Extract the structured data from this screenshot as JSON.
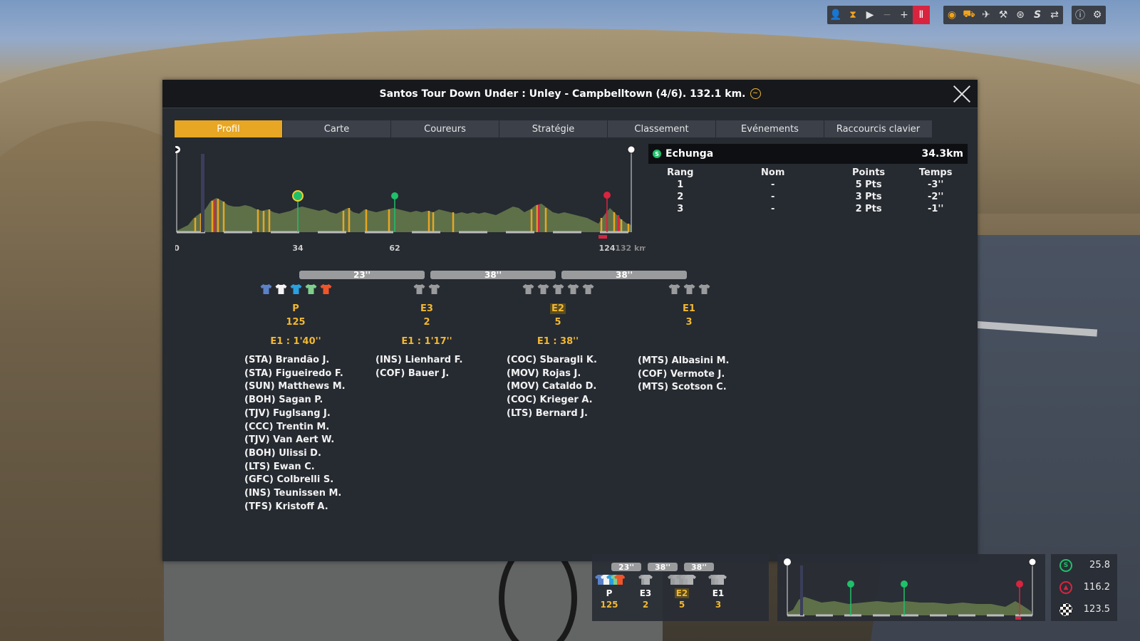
{
  "toolbar": {
    "left_group": [
      "rider-icon",
      "hourglass-icon",
      "play-icon",
      "minus-icon",
      "plus-icon",
      "pause-icon"
    ],
    "right_group": [
      "eye-icon",
      "motorbike-icon",
      "car-icon",
      "helicopter-icon",
      "ball-icon",
      "sprint-s-icon",
      "switch-icon"
    ],
    "extra": [
      "info-icon",
      "settings-icon"
    ]
  },
  "dialog": {
    "title": "Santos Tour Down Under : Unley - Campbelltown (4/6). 132.1 km."
  },
  "tabs": [
    "Profil",
    "Carte",
    "Coureurs",
    "Stratégie",
    "Classement",
    "Evénements",
    "Raccourcis clavier"
  ],
  "profile": {
    "axis_labels": [
      "0",
      "34",
      "62",
      "124"
    ],
    "axis_end": "132 km"
  },
  "sprint": {
    "name": "Echunga",
    "distance": "34.3km",
    "headers": [
      "Rang",
      "Nom",
      "Points",
      "Temps"
    ],
    "rows": [
      [
        "1",
        "-",
        "5 Pts",
        "-3''"
      ],
      [
        "2",
        "-",
        "3 Pts",
        "-2''"
      ],
      [
        "3",
        "-",
        "2 Pts",
        "-1''"
      ]
    ]
  },
  "gaps": [
    "23''",
    "38''",
    "38''"
  ],
  "groups": [
    {
      "name": "P",
      "count": "125",
      "gap": "E1 : 1'40''",
      "riders": [
        "(STA) Brandão J.",
        "(STA) Figueiredo F.",
        "(SUN) Matthews M.",
        "(BOH) Sagan P.",
        "(TJV) Fuglsang J.",
        "(CCC) Trentin M.",
        "(TJV) Van Aert W.",
        "(BOH) Ulissi D.",
        "(LTS) Ewan C.",
        "(GFC) Colbrelli S.",
        "(INS) Teunissen M.",
        "(TFS) Kristoff A."
      ]
    },
    {
      "name": "E3",
      "count": "2",
      "gap": "E1 : 1'17''",
      "riders": [
        "(INS) Lienhard F.",
        "(COF) Bauer J."
      ]
    },
    {
      "name": "E2",
      "count": "5",
      "gap": "E1 : 38''",
      "riders": [
        "(COC) Sbaragli K.",
        "(MOV) Rojas J.",
        "(MOV) Cataldo D.",
        "(COC) Krieger A.",
        "(LTS) Bernard J."
      ]
    },
    {
      "name": "E1",
      "count": "3",
      "gap": "",
      "riders": [
        "(MTS) Albasini M.",
        "(COF) Vermote J.",
        "(MTS) Scotson C."
      ]
    }
  ],
  "hud": {
    "gaps": [
      "23''",
      "38''",
      "38''"
    ],
    "groups": [
      {
        "name": "P",
        "count": "125"
      },
      {
        "name": "E3",
        "count": "2"
      },
      {
        "name": "E2",
        "count": "5"
      },
      {
        "name": "E1",
        "count": "3"
      }
    ],
    "stats": [
      {
        "icon": "sprint-icon",
        "value": "25.8",
        "color": "#1fc06a"
      },
      {
        "icon": "climb-icon",
        "value": "116.2",
        "color": "#d8243f"
      },
      {
        "icon": "finish-flag-icon",
        "value": "123.5",
        "color": "#ffffff"
      }
    ]
  },
  "colors": {
    "accent": "#e7a623",
    "group_label": "#f2b830",
    "sprint_green": "#1fc06a",
    "climb_red": "#d8243f"
  }
}
